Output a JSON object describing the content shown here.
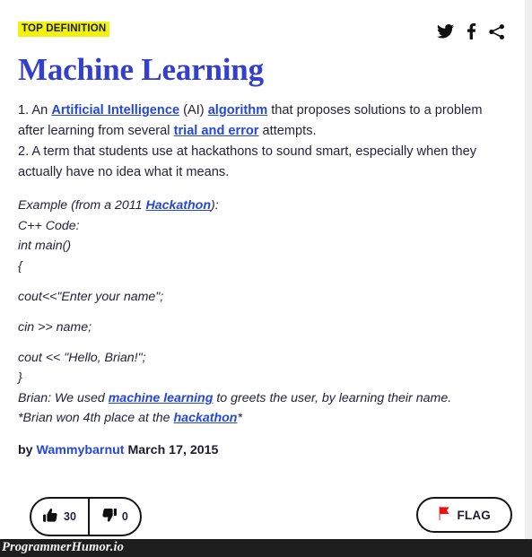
{
  "badge": {
    "label": "TOP DEFINITION"
  },
  "socials": [
    {
      "name": "twitter-share-icon",
      "label": "Twitter"
    },
    {
      "name": "facebook-share-icon",
      "label": "Facebook"
    },
    {
      "name": "share-icon",
      "label": "Share"
    }
  ],
  "title": "Machine Learning",
  "definition": {
    "line1_a": "1. An ",
    "link_ai": "Artificial Intelligence",
    "line1_b": " (AI) ",
    "link_algorithm": "algorithm",
    "line1_c": " that proposes solutions to a problem after learning from several ",
    "link_trial": "trial and error",
    "line1_d": " attempts.",
    "line2": "2. A term that students use at hackathons to sound smart, especially when they actually have no idea what it means."
  },
  "example": {
    "intro_a": "Example (from a 2011 ",
    "link_hackathon": "Hackathon",
    "intro_b": "):",
    "code_lang": "C++ Code:",
    "code_main": "int main()",
    "code_open_brace": "{",
    "code_cout1": "cout<<\"Enter your name\";",
    "code_cin": "cin >> name;",
    "code_cout2": "cout << \"Hello, Brian!\";",
    "code_close_brace": "}",
    "narr_a": "Brian: We used ",
    "link_ml": "machine learning",
    "narr_b": " to greets the user, by learning their name.",
    "footnote_a": "*Brian won 4th place at the ",
    "link_hackathon2": "hackathon",
    "footnote_b": "*"
  },
  "byline": {
    "by": "by ",
    "author": "Wammybarnut",
    "date": " March 17, 2015"
  },
  "actions": {
    "upvote_count": "30",
    "downvote_count": "0",
    "flag_label": "FLAG"
  },
  "watermark": {
    "text": "ProgrammerHumor.io"
  },
  "colors": {
    "title": "#3340cc",
    "link": "#2347dd",
    "badge_bg": "#f2f20d",
    "text": "#22223c",
    "flag_red": "#ee1111",
    "watermark_bg": "#1e1e1e"
  }
}
